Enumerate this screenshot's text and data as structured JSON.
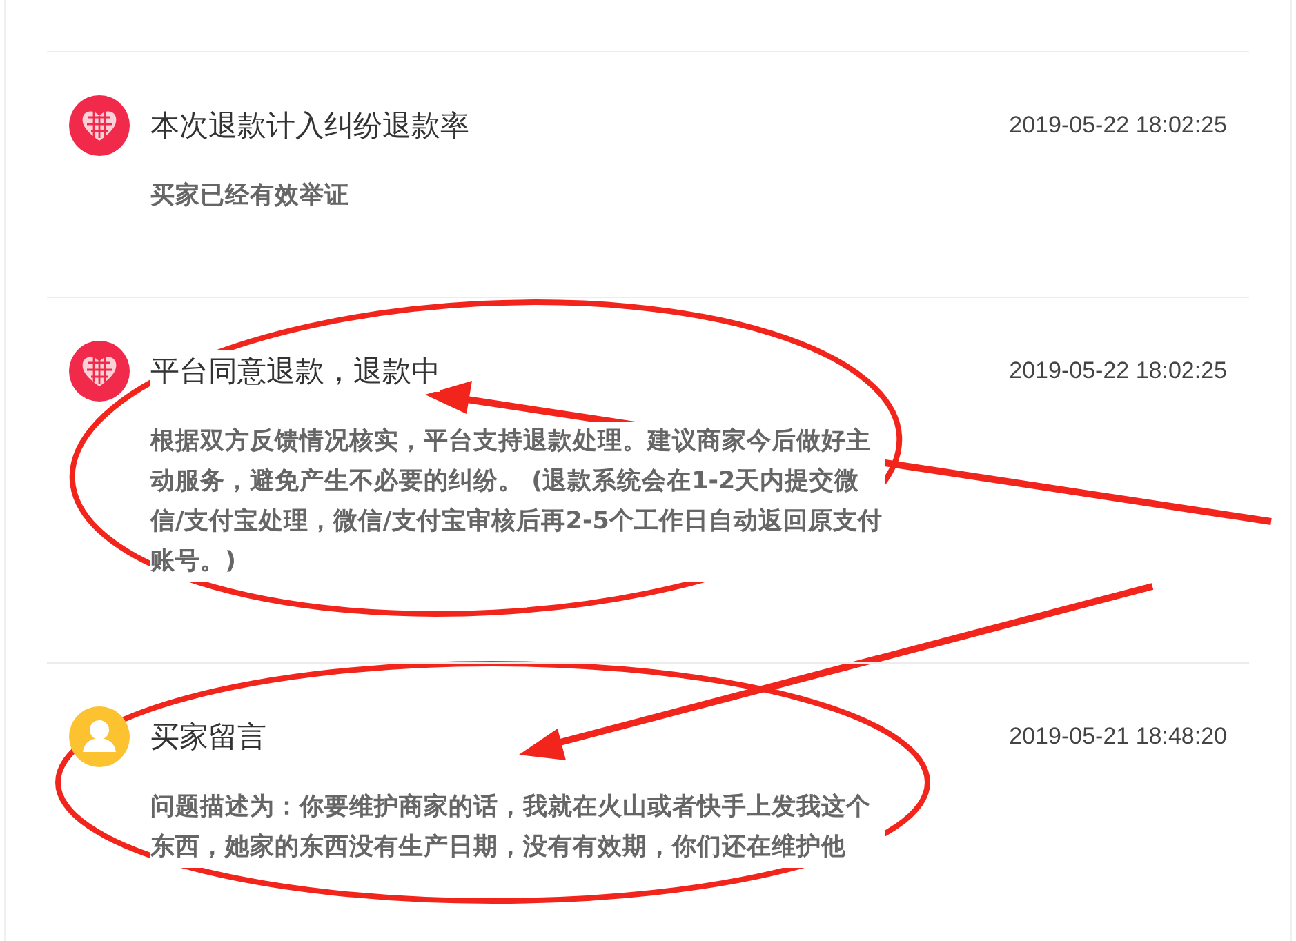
{
  "entries": [
    {
      "kind": "heart",
      "title": "本次退款计入纠纷退款率",
      "time": "2019-05-22 18:02:25",
      "text": "买家已经有效举证"
    },
    {
      "kind": "heart",
      "title": "平台同意退款，退款中",
      "time": "2019-05-22 18:02:25",
      "text": "根据双方反馈情况核实，平台支持退款处理。建议商家今后做好主动服务，避免产生不必要的纠纷。 (退款系统会在1-2天内提交微信/支付宝处理，微信/支付宝审核后再2-5个工作日自动返回原支付账号。)"
    },
    {
      "kind": "user",
      "title": "买家留言",
      "time": "2019-05-21 18:48:20",
      "text": "问题描述为：你要维护商家的话，我就在火山或者快手上发我这个东西，她家的东西没有生产日期，没有有效期，你们还在维护他"
    }
  ]
}
